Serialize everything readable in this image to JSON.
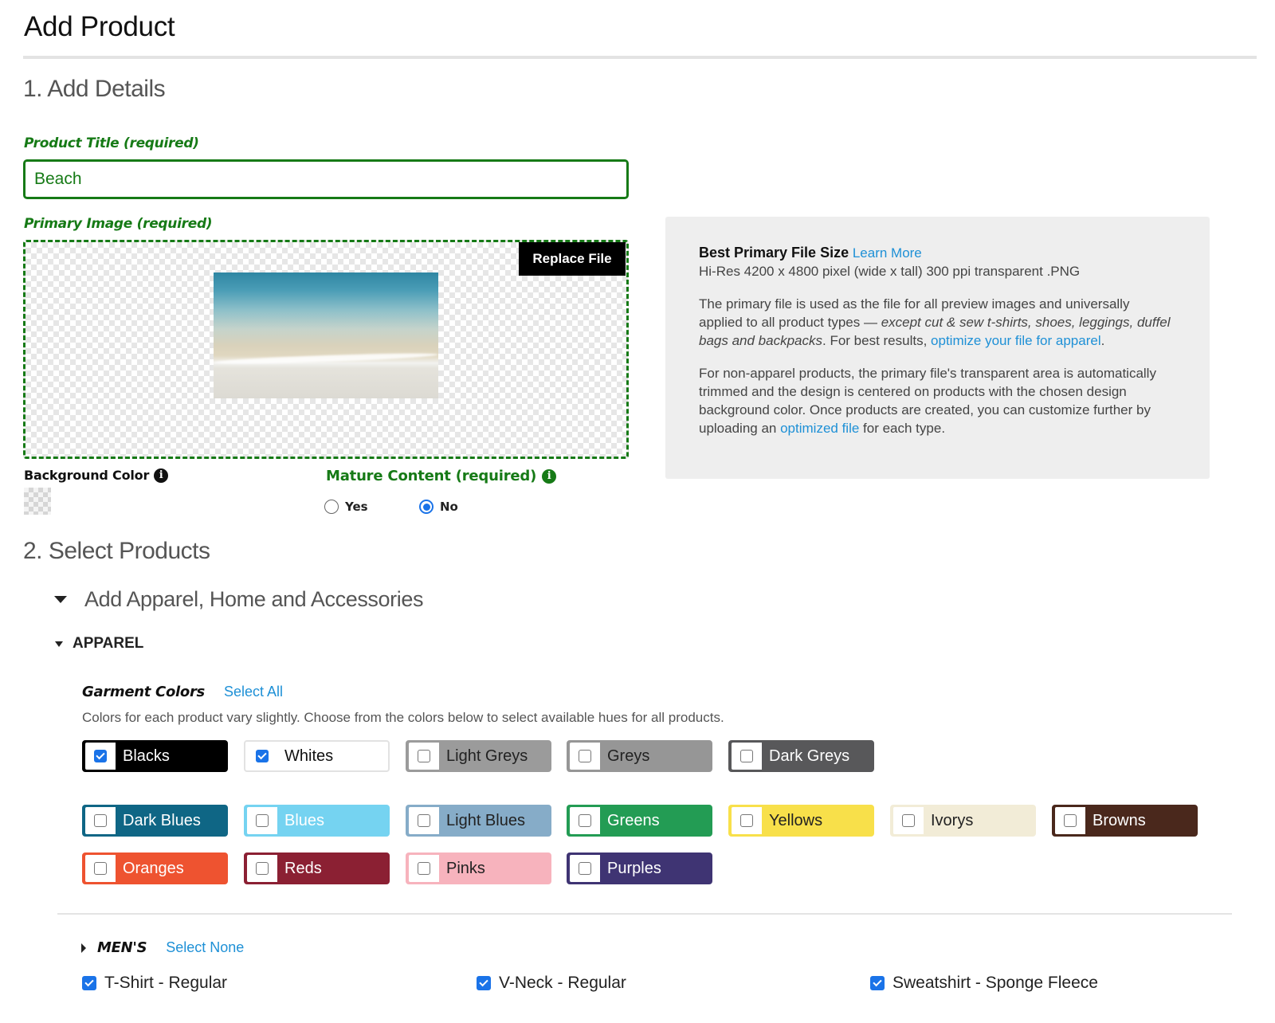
{
  "page": {
    "title": "Add Product"
  },
  "details": {
    "heading": "1. Add Details",
    "product_title": {
      "label": "Product Title (required)",
      "value": "Beach",
      "placeholder": ""
    },
    "primary_image": {
      "label": "Primary Image (required)",
      "replace_label": "Replace File",
      "image_alt": "Beach shoreline photo"
    },
    "background_color": {
      "label": "Background Color",
      "value": "transparent"
    },
    "mature_content": {
      "label": "Mature Content (required)",
      "options": [
        {
          "label": "Yes",
          "selected": false
        },
        {
          "label": "No",
          "selected": true
        }
      ]
    }
  },
  "info_panel": {
    "heading": "Best Primary File Size",
    "learn_more": "Learn More",
    "spec": "Hi-Res 4200 x 4800 pixel (wide x tall) 300 ppi transparent .PNG",
    "p1_start": "The primary file is used as the file for all preview images and universally applied to all product types — ",
    "p1_italic": "except cut & sew t-shirts, shoes, leggings, duffel bags and backpacks",
    "p1_mid": ". For best results, ",
    "p1_link": "optimize your file for apparel",
    "p1_end": ".",
    "p2_start": "For non-apparel products, the primary file's transparent area is automatically trimmed and the design is centered on products with the chosen design background color. Once products are created, you can customize further by uploading an ",
    "p2_link": "optimized file",
    "p2_end": " for each type."
  },
  "products": {
    "heading": "2. Select Products",
    "group_label": "Add Apparel, Home and Accessories",
    "category_label": "APPAREL",
    "garment_colors": {
      "label": "Garment Colors",
      "select_all": "Select All",
      "description": "Colors for each product vary slightly. Choose from the colors below to select available hues for all products.",
      "colors": [
        {
          "name": "Blacks",
          "color": "#000000",
          "text": "#ffffff",
          "border": "#000000",
          "checked": true
        },
        {
          "name": "Whites",
          "color": "#ffffff",
          "text": "#111111",
          "border": "#e2e2e2",
          "checked": true
        },
        {
          "name": "Light Greys",
          "color": "#9b9b9b",
          "text": "#222222",
          "border": "#9b9b9b",
          "checked": false
        },
        {
          "name": "Greys",
          "color": "#969696",
          "text": "#222222",
          "border": "#969696",
          "checked": false
        },
        {
          "name": "Dark Greys",
          "color": "#58585a",
          "text": "#ffffff",
          "border": "#58585a",
          "checked": false
        },
        {
          "name": "Dark Blues",
          "color": "#0f6685",
          "text": "#ffffff",
          "border": "#0f6685",
          "checked": false
        },
        {
          "name": "Blues",
          "color": "#75d3f1",
          "text": "#ffffff",
          "border": "#75d3f1",
          "checked": false
        },
        {
          "name": "Light Blues",
          "color": "#86acc8",
          "text": "#222222",
          "border": "#86acc8",
          "checked": false
        },
        {
          "name": "Greens",
          "color": "#239c54",
          "text": "#ffffff",
          "border": "#239c54",
          "checked": false
        },
        {
          "name": "Yellows",
          "color": "#f8e04a",
          "text": "#222222",
          "border": "#f8e04a",
          "checked": false
        },
        {
          "name": "Ivorys",
          "color": "#f2ecd7",
          "text": "#222222",
          "border": "#f2ecd7",
          "checked": false
        },
        {
          "name": "Browns",
          "color": "#4a281c",
          "text": "#ffffff",
          "border": "#4a281c",
          "checked": false
        },
        {
          "name": "Oranges",
          "color": "#ee5330",
          "text": "#ffffff",
          "border": "#ee5330",
          "checked": false
        },
        {
          "name": "Reds",
          "color": "#8b2033",
          "text": "#ffffff",
          "border": "#8b2033",
          "checked": false
        },
        {
          "name": "Pinks",
          "color": "#f7b3bd",
          "text": "#222222",
          "border": "#f7b3bd",
          "checked": false
        },
        {
          "name": "Purples",
          "color": "#3f3473",
          "text": "#ffffff",
          "border": "#3f3473",
          "checked": false
        }
      ]
    },
    "mens": {
      "label": "MEN'S",
      "select_none": "Select None",
      "items": [
        {
          "name": "T-Shirt - Regular",
          "checked": true
        },
        {
          "name": "V-Neck - Regular",
          "checked": true
        },
        {
          "name": "Sweatshirt - Sponge Fleece",
          "checked": true
        }
      ]
    }
  },
  "colors": {
    "accent_green": "#167a16",
    "link_blue": "#1e90d6",
    "check_blue": "#1a73e8"
  }
}
